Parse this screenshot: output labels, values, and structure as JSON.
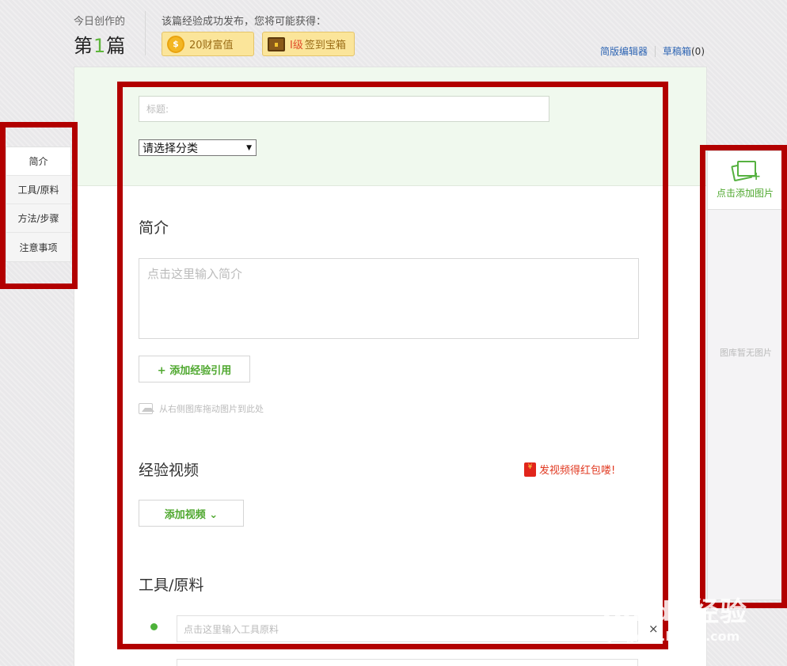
{
  "header": {
    "today_label": "今日创作的",
    "today_prefix": "第",
    "today_count": "1",
    "today_suffix": "篇",
    "reward_label": "该篇经验成功发布，您将可能获得：",
    "wealth_badge": "20财富值",
    "chest_level": "I级",
    "chest_label": "签到宝箱",
    "simple_editor_link": "简版编辑器",
    "drafts_link": "草稿箱",
    "drafts_count": "(0)"
  },
  "left_nav": {
    "items": [
      {
        "label": "简介"
      },
      {
        "label": "工具/原料"
      },
      {
        "label": "方法/步骤"
      },
      {
        "label": "注意事项"
      }
    ]
  },
  "form": {
    "title_placeholder": "标题:",
    "category_value": "请选择分类",
    "intro_heading": "简介",
    "intro_placeholder": "点击这里输入简介",
    "add_ref_button": "+  添加经验引用",
    "drag_hint": "从右侧图库拖动图片到此处",
    "video_heading": "经验视频",
    "video_promo": "发视频得红包喽!",
    "redpack_symbol": "¥",
    "add_video_button": "添加视频 ⌄",
    "tools_heading": "工具/原料",
    "tools_placeholder": "点击这里输入工具原料",
    "close_symbol": "×"
  },
  "gallery": {
    "add_picture_label": "点击添加图片",
    "empty_text": "图库暂无图片"
  },
  "watermark": {
    "brand": "Baidu经验",
    "url": "jingyan.baidu.com"
  },
  "colors": {
    "accent_green": "#4fa82f",
    "annotation_red": "#b20000",
    "link_blue": "#2d64b3"
  }
}
